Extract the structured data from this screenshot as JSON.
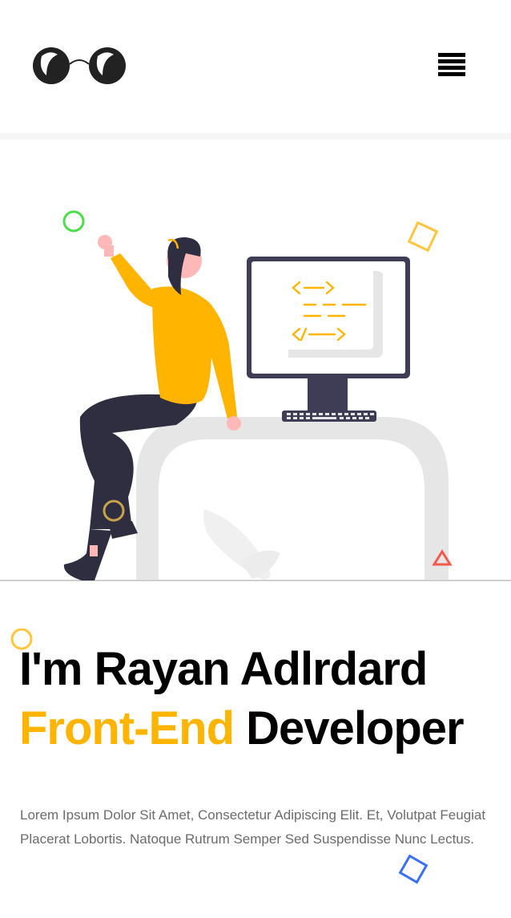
{
  "header": {
    "logo_name": "glasses-logo",
    "menu_icon": "hamburger-menu-icon"
  },
  "hero": {
    "title_line1": "I'm Rayan Adlrdard",
    "title_accent": "Front-End",
    "title_rest": "Developer",
    "description": "Lorem Ipsum Dolor Sit Amet, Consectetur Adipiscing Elit. Et, Volutpat Feugiat Placerat Lobortis. Natoque Rutrum Semper Sed Suspendisse Nunc Lectus."
  },
  "colors": {
    "accent": "#ffb400",
    "text": "#000000",
    "muted": "#6b6b6b",
    "deco_green": "#4ade4a",
    "deco_blue": "#3b6ff5",
    "deco_red": "#f05a4a",
    "deco_yellow": "#ffc53d"
  }
}
